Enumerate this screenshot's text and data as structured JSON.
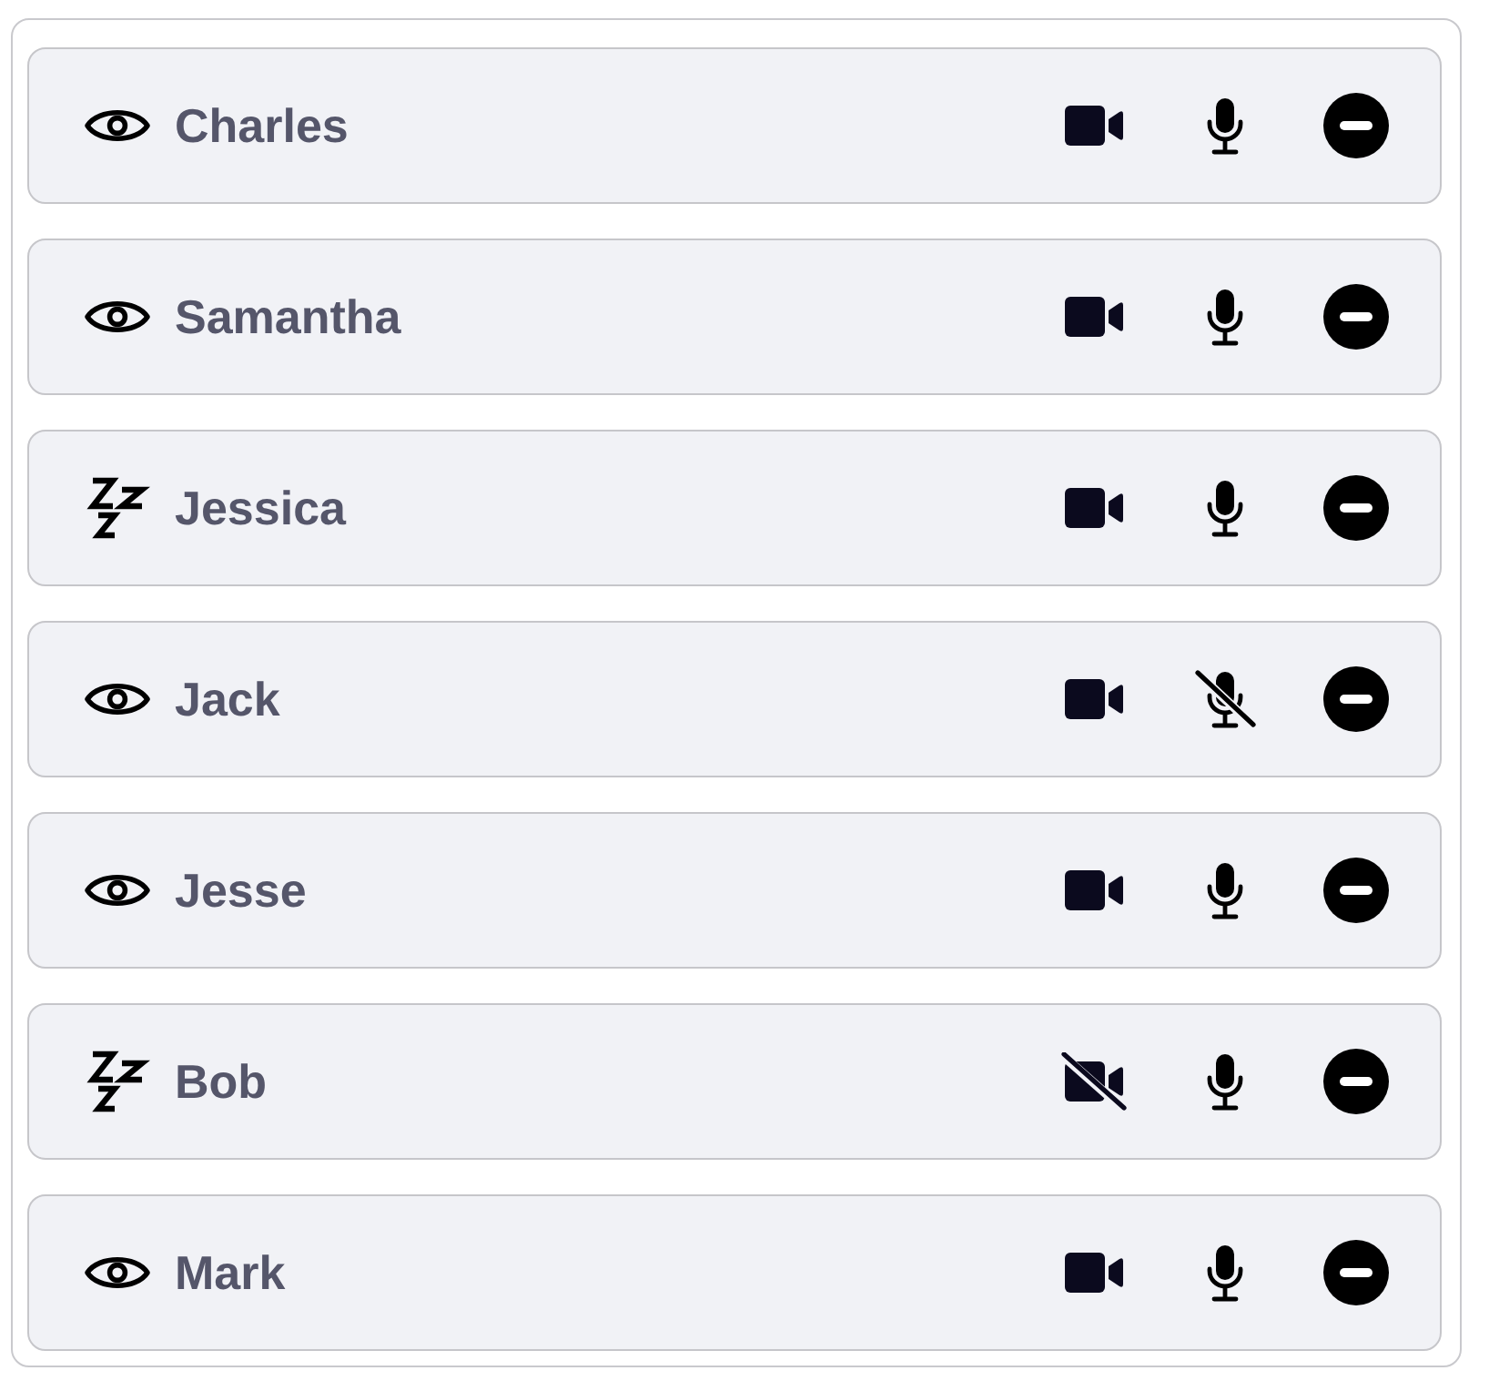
{
  "participants": [
    {
      "name": "Charles",
      "asleep": false,
      "video_on": true,
      "mic_on": true
    },
    {
      "name": "Samantha",
      "asleep": false,
      "video_on": true,
      "mic_on": true
    },
    {
      "name": "Jessica",
      "asleep": true,
      "video_on": true,
      "mic_on": true
    },
    {
      "name": "Jack",
      "asleep": false,
      "video_on": true,
      "mic_on": false
    },
    {
      "name": "Jesse",
      "asleep": false,
      "video_on": true,
      "mic_on": true
    },
    {
      "name": "Bob",
      "asleep": true,
      "video_on": false,
      "mic_on": true
    },
    {
      "name": "Mark",
      "asleep": false,
      "video_on": true,
      "mic_on": true
    }
  ]
}
